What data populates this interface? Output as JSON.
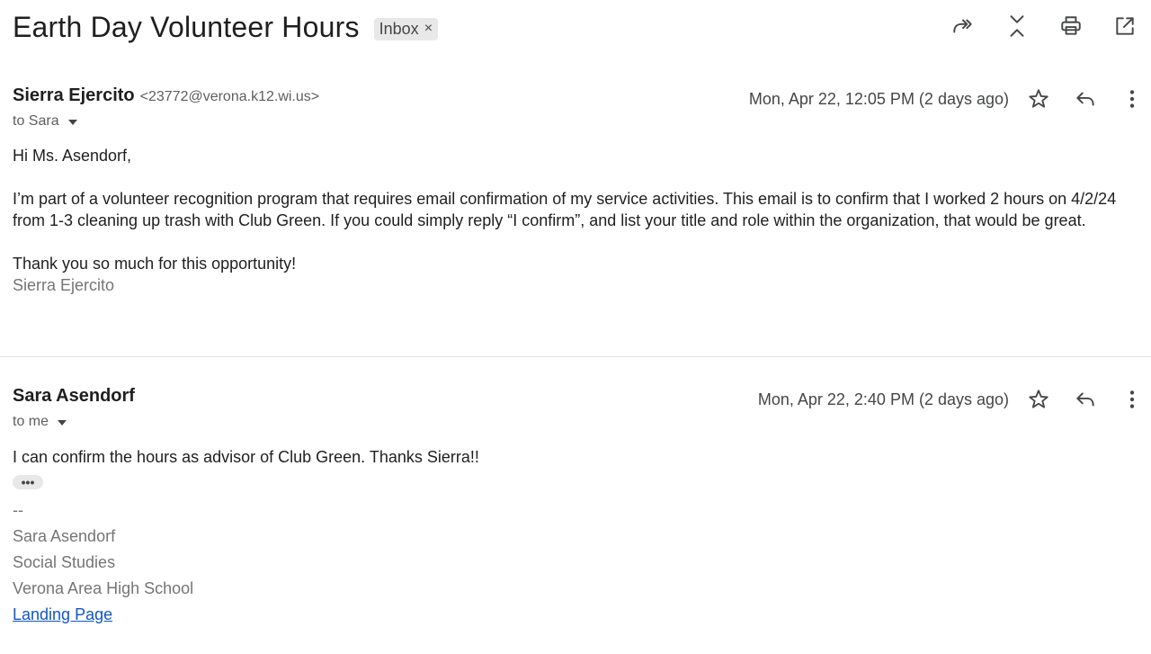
{
  "thread": {
    "subject": "Earth Day Volunteer Hours",
    "label": "Inbox",
    "label_close": "×"
  },
  "toolbar": {
    "icons": [
      "forward-all-icon",
      "collapse-icon",
      "print-icon",
      "open-new-window-icon"
    ]
  },
  "messages": [
    {
      "sender_name": "Sierra Ejercito",
      "sender_email": "<23772@verona.k12.wi.us>",
      "to": "to Sara",
      "date": "Mon, Apr 22, 12:05 PM (2 days ago)",
      "body": {
        "greeting": "Hi Ms. Asendorf,",
        "paragraph": "I’m part of a volunteer recognition program that requires email confirmation of my service activities. This email is to confirm that I worked 2 hours on 4/2/24 from 1-3 cleaning up trash with Club Green. If you could simply reply “I confirm”, and list your title and role within the organization, that would be great.",
        "closing": "Thank you so much for this opportunity!",
        "signature": "Sierra Ejercito"
      }
    },
    {
      "sender_name": "Sara Asendorf",
      "to": "to me",
      "date": "Mon, Apr 22, 2:40 PM (2 days ago)",
      "body": {
        "text": "I can confirm the hours as advisor of Club Green. Thanks Sierra!!",
        "ellipsis": "•••",
        "sig_dash": "--",
        "sig_name": "Sara Asendorf",
        "sig_dept": "Social Studies",
        "sig_school": "Verona Area High School",
        "sig_link": "Landing Page"
      }
    }
  ]
}
